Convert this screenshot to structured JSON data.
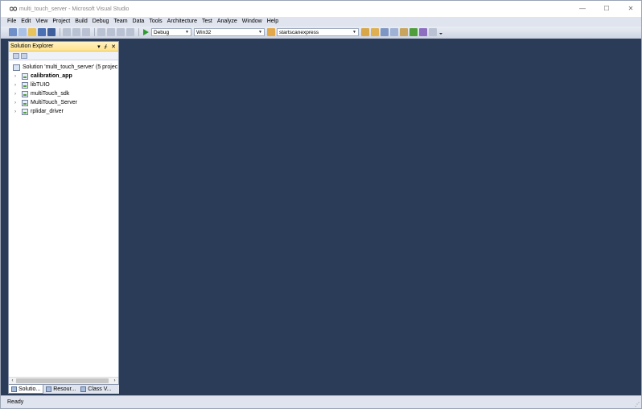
{
  "window": {
    "title": "multi_touch_server - Microsoft Visual Studio",
    "minimize_glyph": "—",
    "maximize_glyph": "☐",
    "close_glyph": "✕"
  },
  "menu": [
    "File",
    "Edit",
    "View",
    "Project",
    "Build",
    "Debug",
    "Team",
    "Data",
    "Tools",
    "Architecture",
    "Test",
    "Analyze",
    "Window",
    "Help"
  ],
  "toolbar": {
    "configuration": "Debug",
    "platform": "Win32",
    "find_text": "startscanexpress"
  },
  "solution_explorer": {
    "title": "Solution Explorer",
    "pin_glyph": "▾ ᚋ ✕",
    "solution_label": "Solution 'multi_touch_server' (5 projec",
    "projects": [
      {
        "name": "calibration_app",
        "bold": true
      },
      {
        "name": "libTUIO",
        "bold": false
      },
      {
        "name": "multiTouch_sdk",
        "bold": false
      },
      {
        "name": "MultiTouch_Server",
        "bold": false
      },
      {
        "name": "rplidar_driver",
        "bold": false
      }
    ]
  },
  "panel_tabs": [
    "Solutio...",
    "Resour...",
    "Class V..."
  ],
  "status": {
    "text": "Ready"
  },
  "colors": {
    "editor_background": "#2b3c59",
    "menubar": "#dfe4ee",
    "panel_header": "#ffe28a"
  }
}
